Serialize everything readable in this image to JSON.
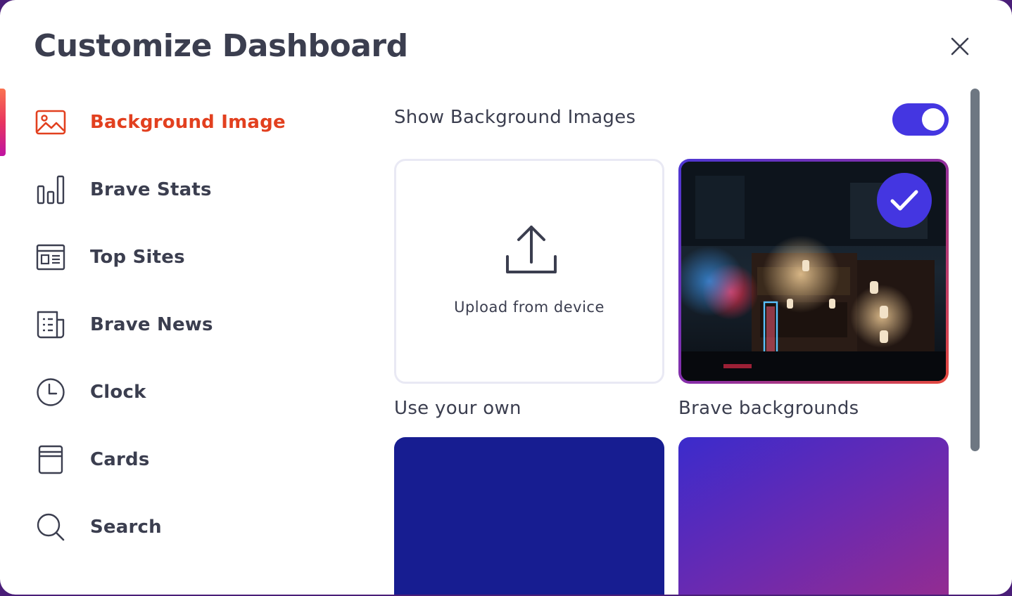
{
  "dialog": {
    "title": "Customize Dashboard",
    "close_icon": "close-icon"
  },
  "sidebar": {
    "active_index": 0,
    "items": [
      {
        "label": "Background Image",
        "icon": "image-icon"
      },
      {
        "label": "Brave Stats",
        "icon": "bar-chart-icon"
      },
      {
        "label": "Top Sites",
        "icon": "top-sites-icon"
      },
      {
        "label": "Brave News",
        "icon": "news-icon"
      },
      {
        "label": "Clock",
        "icon": "clock-icon"
      },
      {
        "label": "Cards",
        "icon": "cards-icon"
      },
      {
        "label": "Search",
        "icon": "search-icon"
      }
    ]
  },
  "main": {
    "toggle_label": "Show Background Images",
    "toggle_on": true,
    "upload": {
      "label": "Upload from device",
      "caption": "Use your own",
      "icon": "upload-icon"
    },
    "brave": {
      "caption": "Brave backgrounds",
      "selected": true,
      "icon": "checkmark-icon"
    }
  },
  "colors": {
    "accent": "#4436e1",
    "active_nav": "#e2401f",
    "text": "#3b3e4f",
    "solid_tile": "#171d91"
  }
}
